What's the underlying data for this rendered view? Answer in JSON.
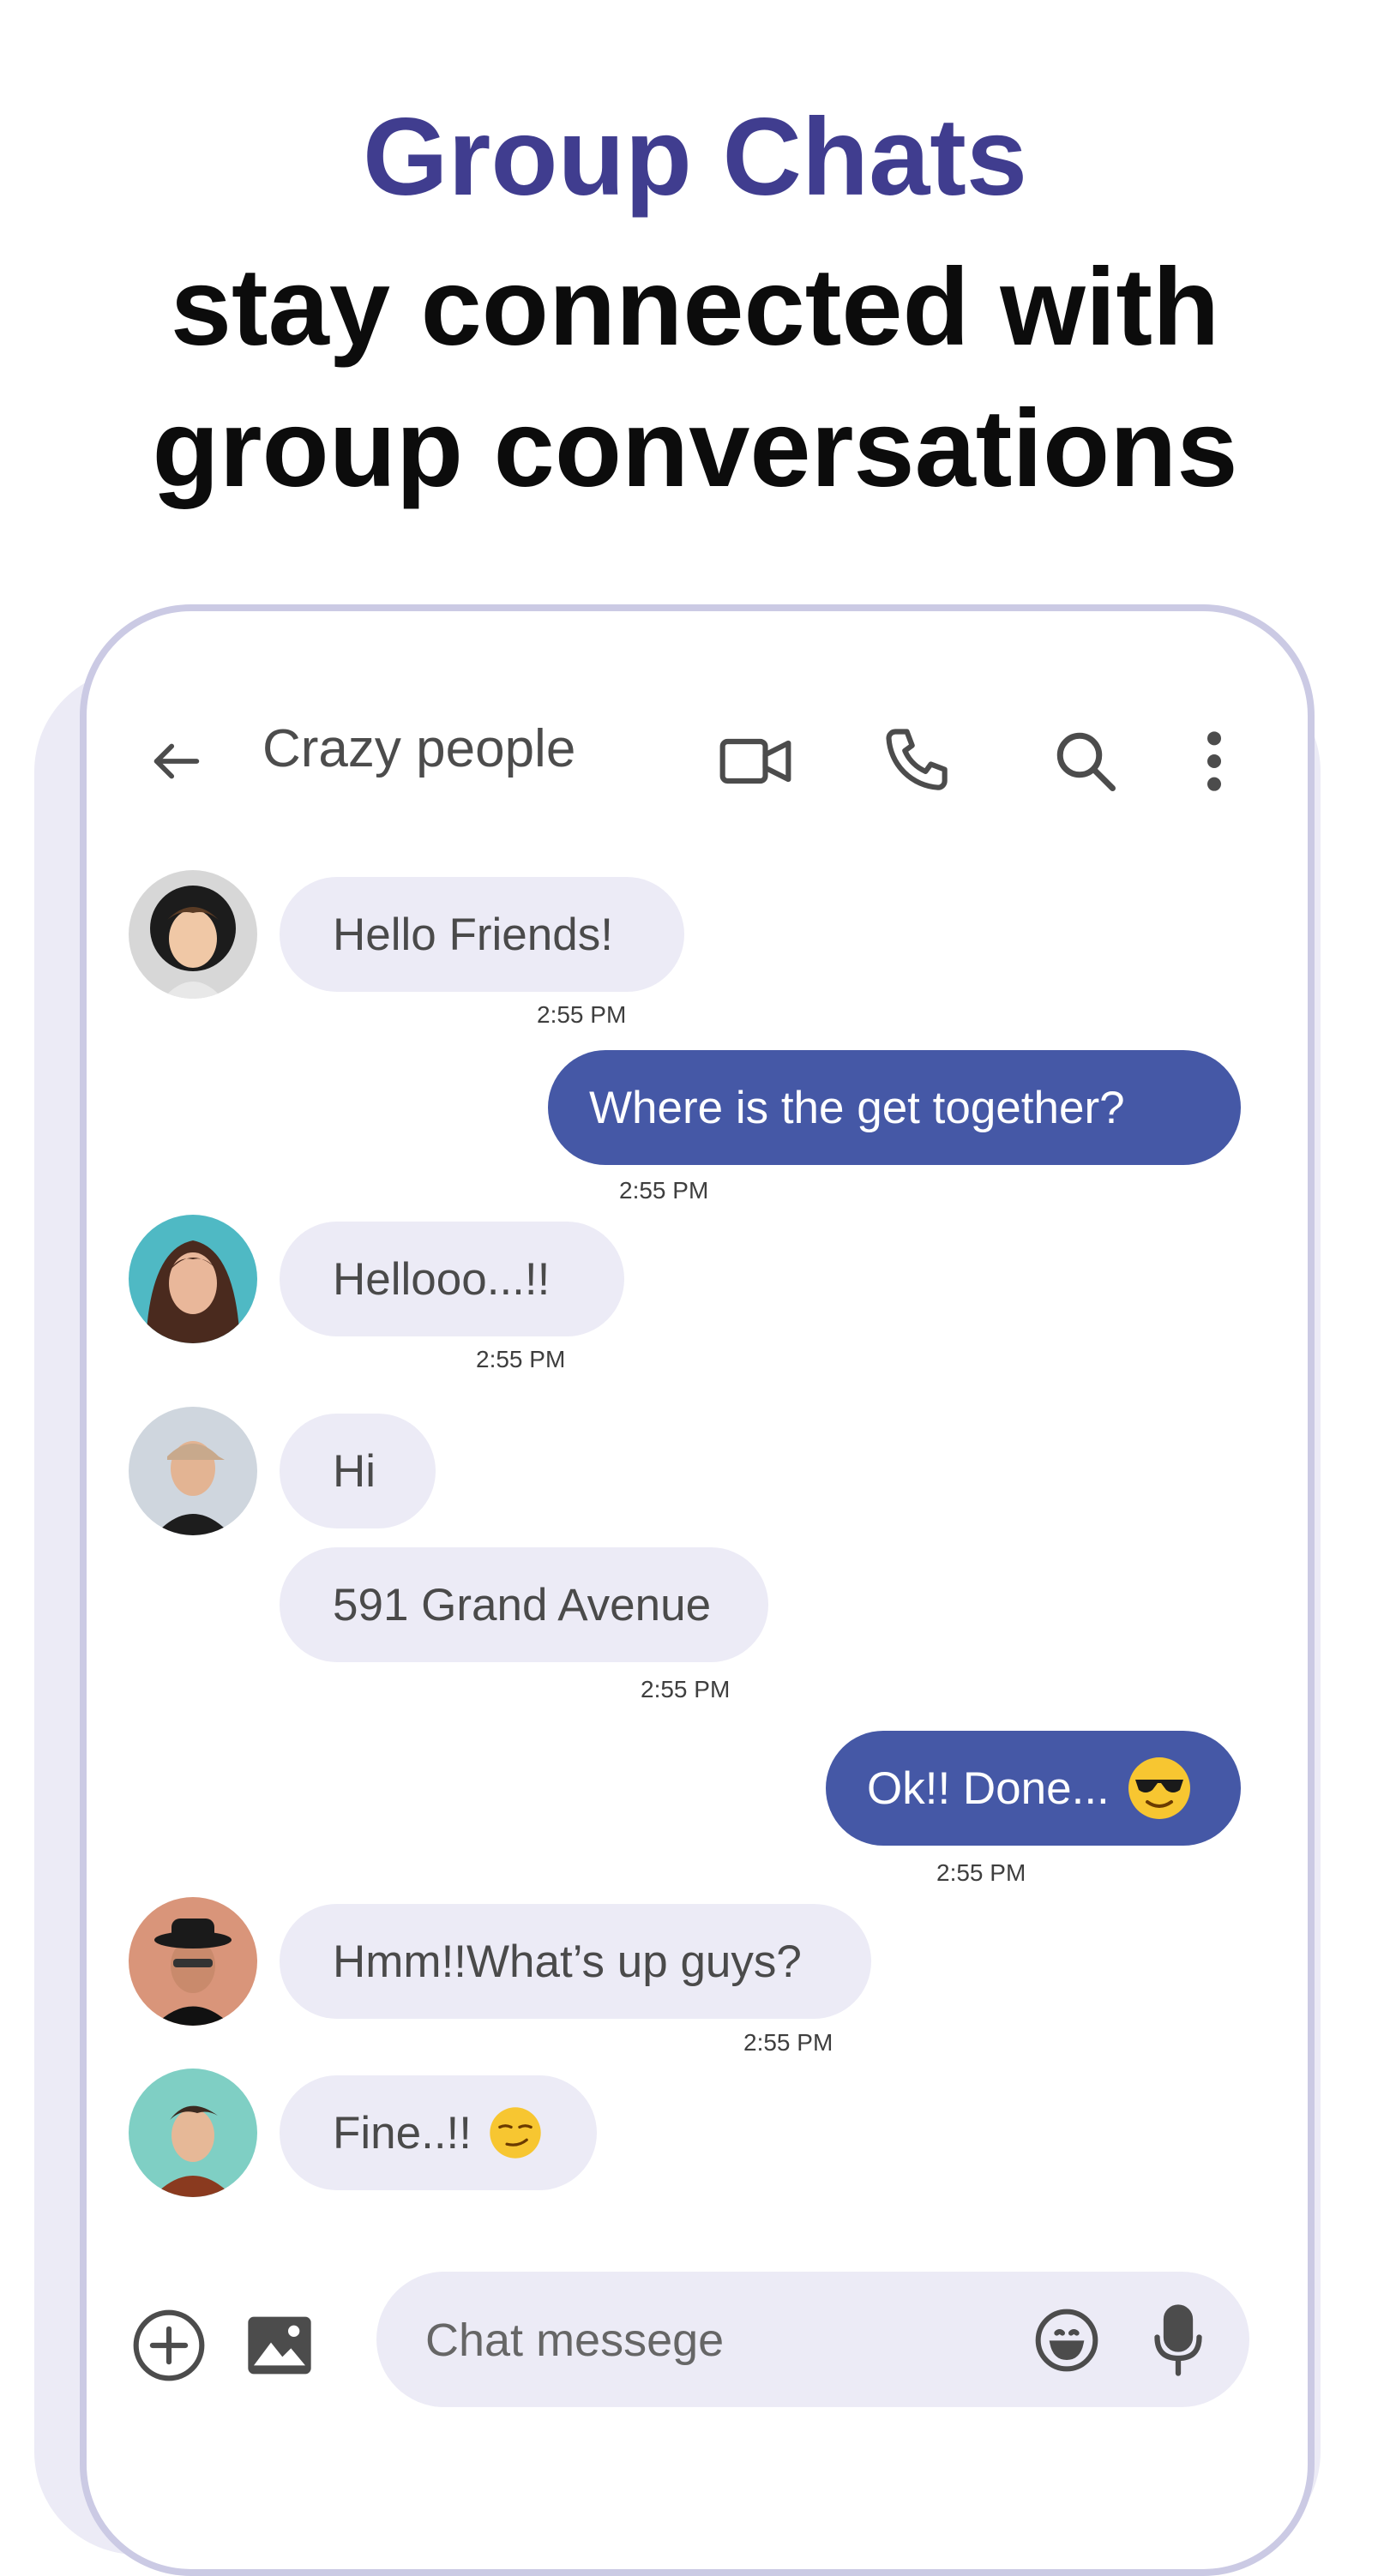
{
  "headline": {
    "title": "Group Chats",
    "line1": "stay connected with",
    "line2": "group conversations"
  },
  "colors": {
    "accent": "#403d8f",
    "outgoing_bubble": "#4558a6",
    "incoming_bubble": "#ecebf6",
    "frame": "#cbcae4"
  },
  "topbar": {
    "back_icon": "arrow-left-icon",
    "title": "Crazy people",
    "icons": [
      "video-camera-icon",
      "phone-icon",
      "search-icon",
      "more-vertical-icon"
    ]
  },
  "messages": [
    {
      "direction": "incoming",
      "avatar": "avatar-curly-hair",
      "text": "Hello Friends!",
      "time": "2:55 PM"
    },
    {
      "direction": "outgoing",
      "text": "Where is the get together?",
      "time": "2:55 PM"
    },
    {
      "direction": "incoming",
      "avatar": "avatar-long-hair",
      "text": "Hellooo...!!",
      "time": "2:55 PM"
    },
    {
      "direction": "incoming",
      "avatar": "avatar-cap",
      "text": "Hi"
    },
    {
      "direction": "incoming",
      "text": "591 Grand Avenue",
      "time": "2:55 PM"
    },
    {
      "direction": "outgoing",
      "text": "Ok!! Done...",
      "emoji": "smiling-face-with-sunglasses",
      "time": "2:55 PM"
    },
    {
      "direction": "incoming",
      "avatar": "avatar-hat-sunglasses",
      "text": "Hmm!!What’s up guys?",
      "time": "2:55 PM"
    },
    {
      "direction": "incoming",
      "avatar": "avatar-teal-background",
      "text": "Fine..!!",
      "emoji": "smirking-face"
    }
  ],
  "composer": {
    "add_icon": "plus-circle-icon",
    "image_icon": "image-icon",
    "placeholder": "Chat messege",
    "emoji_icon": "smiley-icon",
    "mic_icon": "microphone-icon"
  }
}
